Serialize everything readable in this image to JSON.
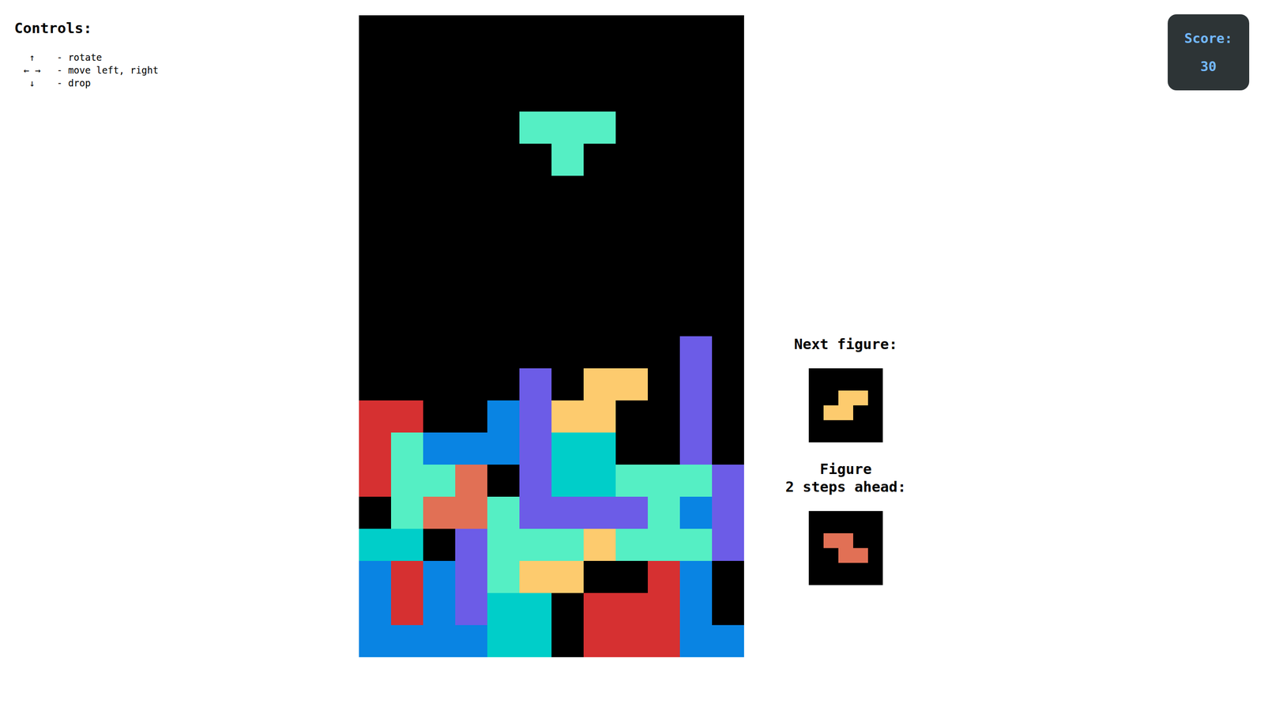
{
  "controls": {
    "title": "Controls:",
    "items": [
      {
        "key": "↑",
        "action": "- rotate"
      },
      {
        "key": "← →",
        "action": "- move left, right"
      },
      {
        "key": "↓",
        "action": "- drop"
      }
    ]
  },
  "board": {
    "columns": 12,
    "rows": [
      [
        null,
        null,
        null,
        null,
        null,
        null,
        null,
        null,
        null,
        null,
        null,
        null
      ],
      [
        null,
        null,
        null,
        null,
        null,
        null,
        null,
        null,
        null,
        null,
        null,
        null
      ],
      [
        null,
        null,
        null,
        null,
        null,
        null,
        null,
        null,
        null,
        null,
        null,
        null
      ],
      [
        null,
        null,
        null,
        null,
        null,
        null,
        null,
        null,
        null,
        null,
        null,
        null
      ],
      [
        null,
        null,
        null,
        null,
        null,
        null,
        null,
        null,
        null,
        null,
        null,
        null
      ],
      [
        null,
        null,
        null,
        null,
        null,
        null,
        null,
        null,
        null,
        null,
        null,
        null
      ],
      [
        null,
        null,
        null,
        null,
        null,
        null,
        null,
        null,
        null,
        null,
        null,
        null
      ],
      [
        null,
        null,
        null,
        null,
        null,
        null,
        null,
        null,
        null,
        null,
        null,
        null
      ],
      [
        null,
        null,
        null,
        null,
        null,
        null,
        null,
        null,
        null,
        null,
        null,
        null
      ],
      [
        null,
        null,
        null,
        null,
        null,
        null,
        null,
        null,
        null,
        null,
        null,
        null
      ],
      [
        null,
        null,
        null,
        null,
        null,
        null,
        null,
        null,
        null,
        null,
        "#6c5ce7",
        null
      ],
      [
        null,
        null,
        null,
        null,
        null,
        "#6c5ce7",
        null,
        "#fdcb6e",
        "#fdcb6e",
        null,
        "#6c5ce7",
        null
      ],
      [
        "#d63031",
        "#d63031",
        null,
        null,
        "#0984e3",
        "#6c5ce7",
        "#fdcb6e",
        "#fdcb6e",
        null,
        null,
        "#6c5ce7",
        null
      ],
      [
        "#d63031",
        "#55efc4",
        "#0984e3",
        "#0984e3",
        "#0984e3",
        "#6c5ce7",
        "#00cec9",
        "#00cec9",
        null,
        null,
        "#6c5ce7",
        null
      ],
      [
        "#d63031",
        "#55efc4",
        "#55efc4",
        "#e17055",
        null,
        "#6c5ce7",
        "#00cec9",
        "#00cec9",
        "#55efc4",
        "#55efc4",
        "#55efc4",
        "#6c5ce7"
      ],
      [
        null,
        "#55efc4",
        "#e17055",
        "#e17055",
        "#55efc4",
        "#6c5ce7",
        "#6c5ce7",
        "#6c5ce7",
        "#6c5ce7",
        "#55efc4",
        "#0984e3",
        "#6c5ce7"
      ],
      [
        "#00cec9",
        "#00cec9",
        null,
        "#6c5ce7",
        "#55efc4",
        "#55efc4",
        "#55efc4",
        "#fdcb6e",
        "#55efc4",
        "#55efc4",
        "#55efc4",
        "#6c5ce7"
      ],
      [
        "#0984e3",
        "#d63031",
        "#0984e3",
        "#6c5ce7",
        "#55efc4",
        "#fdcb6e",
        "#fdcb6e",
        null,
        null,
        "#d63031",
        "#0984e3",
        null
      ],
      [
        "#0984e3",
        "#d63031",
        "#0984e3",
        "#6c5ce7",
        "#00cec9",
        "#00cec9",
        null,
        "#d63031",
        "#d63031",
        "#d63031",
        "#0984e3",
        null
      ],
      [
        "#0984e3",
        "#0984e3",
        "#0984e3",
        "#0984e3",
        "#00cec9",
        "#00cec9",
        null,
        "#d63031",
        "#d63031",
        "#d63031",
        "#0984e3",
        "#0984e3"
      ]
    ]
  },
  "active_piece": {
    "color": "#55efc4",
    "cells": [
      [
        3,
        5
      ],
      [
        3,
        6
      ],
      [
        3,
        7
      ],
      [
        4,
        6
      ]
    ]
  },
  "next_figure": {
    "label_lines": [
      "Next figure:"
    ],
    "color": "#fdcb6e",
    "shape": [
      [
        0,
        1,
        1
      ],
      [
        1,
        1,
        0
      ]
    ]
  },
  "figure_after": {
    "label_lines": [
      "Figure",
      "2 steps ahead:"
    ],
    "color": "#e17055",
    "shape": [
      [
        1,
        1,
        0
      ],
      [
        0,
        1,
        1
      ]
    ]
  },
  "score": {
    "label": "Score:",
    "value": "30"
  }
}
